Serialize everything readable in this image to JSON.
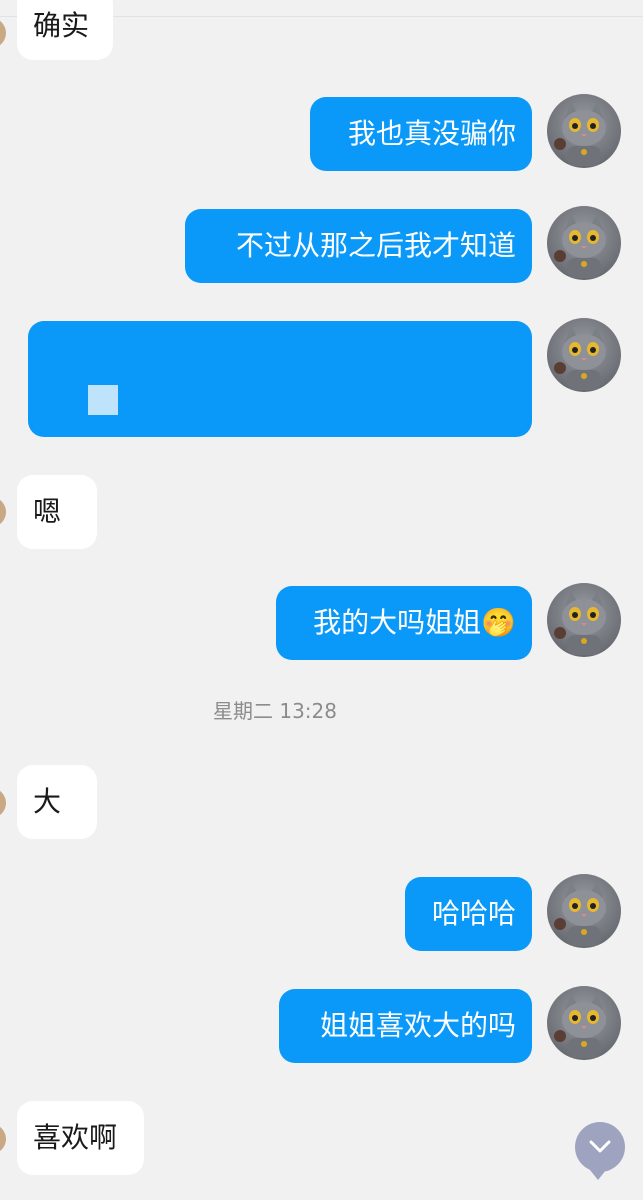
{
  "conversation": {
    "messages": [
      {
        "side": "in",
        "text": "确实"
      },
      {
        "side": "out",
        "text": "我也真没骗你"
      },
      {
        "side": "out",
        "text": "不过从那之后我才知道"
      },
      {
        "side": "out",
        "text": "",
        "redacted": true
      },
      {
        "side": "in",
        "text": "嗯"
      },
      {
        "side": "out",
        "text": "我的大吗姐姐🤭"
      },
      {
        "side": "in",
        "text": "大"
      },
      {
        "side": "out",
        "text": "哈哈哈"
      },
      {
        "side": "out",
        "text": "姐姐喜欢大的吗"
      },
      {
        "side": "in",
        "text": "喜欢啊"
      }
    ],
    "timestamp": "星期二 13:28"
  },
  "avatar": {
    "icon": "cat-avatar-icon"
  },
  "scroll_button": {
    "icon": "chevron-down-icon"
  },
  "colors": {
    "outgoing": "#0a99f8",
    "incoming": "#ffffff",
    "background": "#f1f1f1"
  }
}
